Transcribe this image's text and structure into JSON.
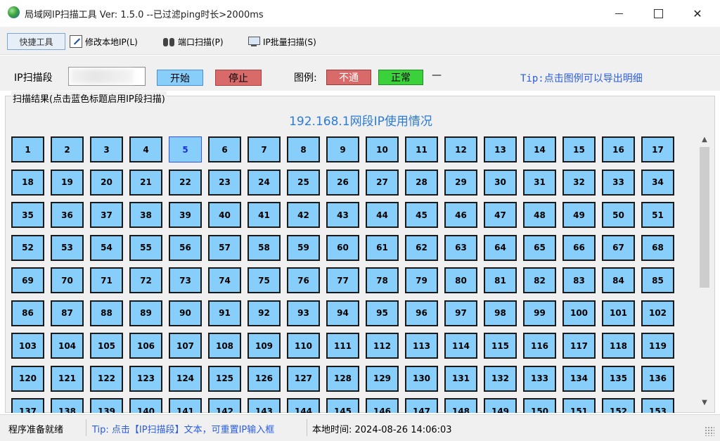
{
  "window": {
    "title": "局域网IP扫描工具  Ver: 1.5.0  --已过滤ping时长>2000ms",
    "minimize": "",
    "maximize": "",
    "close": "✕"
  },
  "toolbar": {
    "quick_tools": "快捷工具",
    "modify_ip": "修改本地IP(L)",
    "port_scan": "端口扫描(P)",
    "batch_scan": "IP批量扫描(S)"
  },
  "controls": {
    "segment_label": "IP扫描段",
    "segment_value": "",
    "start_button": "开始",
    "stop_button": "停止",
    "legend_label": "图例:",
    "legend_fail": "不通",
    "legend_ok": "正常",
    "legend_dash": "—",
    "tip": "Tip:点击图例可以导出明细"
  },
  "results": {
    "caption": "扫描结果(点击蓝色标题启用IP段扫描)",
    "segment_title": "192.168.1网段IP使用情况",
    "selected_ip": 5,
    "visible_count": 153
  },
  "colors": {
    "cell_bg": "#87cefa",
    "fail": "#d96a6a",
    "ok": "#3bd13b",
    "tip": "#2b5de3"
  },
  "status": {
    "ready": "程序准备就绪",
    "tip": "Tip: 点击【IP扫描段】文本，可重置IP输入框",
    "time": "本地时间: 2024-08-26 14:06:03"
  },
  "scrollbar": {
    "up": "▲",
    "down": "▼"
  }
}
